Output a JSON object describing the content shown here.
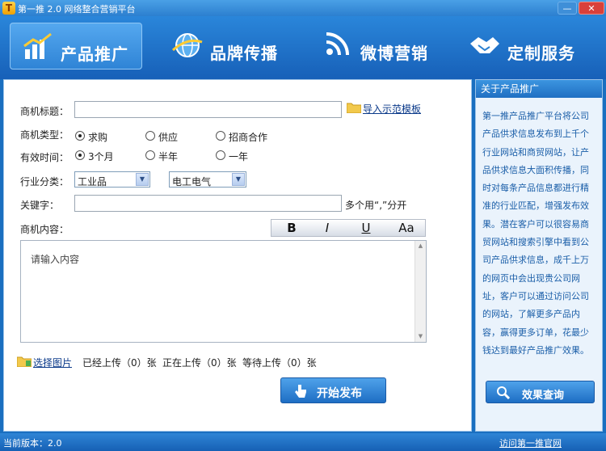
{
  "app": {
    "icon_letter": "T",
    "title": "第一推 2.0 网络整合营销平台",
    "min_label": "—",
    "close_label": "✕"
  },
  "nav": {
    "items": [
      {
        "label": "产品推广",
        "icon": "bar-chart-icon",
        "active": true
      },
      {
        "label": "品牌传播",
        "icon": "globe-icon",
        "active": false
      },
      {
        "label": "微博营销",
        "icon": "rss-icon",
        "active": false
      },
      {
        "label": "定制服务",
        "icon": "handshake-icon",
        "active": false
      }
    ]
  },
  "form": {
    "title_label": "商机标题：",
    "title_value": "",
    "import_link": "导入示范模板",
    "type_label": "商机类型：",
    "type_options": [
      "求购",
      "供应",
      "招商合作"
    ],
    "type_selected": "求购",
    "period_label": "有效时间：",
    "period_options": [
      "3个月",
      "半年",
      "一年"
    ],
    "period_selected": "3个月",
    "industry_label": "行业分类：",
    "industry_main": "工业品",
    "industry_sub": "电工电气",
    "keyword_label": "关键字：",
    "keyword_value": "",
    "keyword_hint": "多个用“,”分开",
    "content_label": "商机内容：",
    "toolbar": {
      "bold": "B",
      "italic": "I",
      "underline": "U",
      "font": "Aa"
    },
    "content_placeholder": "请输入内容",
    "choose_image": "选择图片",
    "uploaded": "已经上传（0）张",
    "uploading": "正在上传（0）张",
    "waiting": "等待上传（0）张",
    "publish_button": "开始发布"
  },
  "panel": {
    "header": "关于产品推广",
    "lines": [
      "第一推产品推广平台将公司",
      "产品供求信息发布到上千个",
      "行业网站和商贸网站，让产",
      "品供求信息大面积传播，同",
      "时对每条产品信息都进行精",
      "准的行业匹配，增强发布效",
      "果。潜在客户可以很容易商",
      "贸网站和搜索引擎中看到公",
      "司产品供求信息，成千上万",
      "的网页中会出现贵公司网",
      "址，客户可以通过访问公司",
      "的网站，了解更多产品内",
      "容，赢得更多订单，花最少",
      "钱达到最好产品推广效果。"
    ],
    "query_button": "效果查询"
  },
  "status": {
    "version": "当前版本：2.0",
    "link": "访问第一推官网"
  }
}
